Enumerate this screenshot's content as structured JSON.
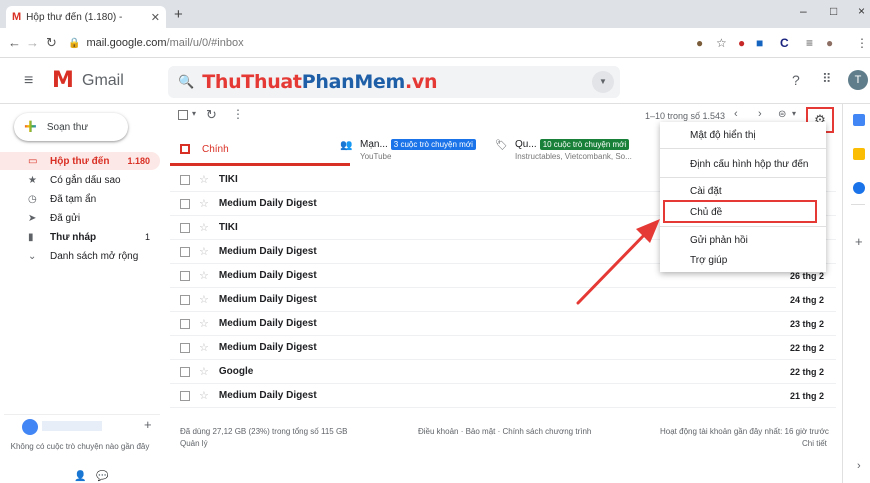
{
  "browser": {
    "tab_title": "Hộp thư đến (1.180) -",
    "tab_favicon": "M",
    "new_tab": "+",
    "url_host": "mail.google.com",
    "url_path": "/mail/u/0/#inbox",
    "win_min": "–",
    "win_max": "□",
    "win_close": "×"
  },
  "header": {
    "app_name": "Gmail",
    "logo_letter": "M",
    "watermark_part1": "ThuThuat",
    "watermark_part2": "PhanMem",
    "watermark_part3": ".vn",
    "avatar_letter": "T"
  },
  "sidebar": {
    "compose_label": "Soạn thư",
    "items": [
      {
        "label": "Hộp thư đến",
        "count": "1.180",
        "icon": "inbox-icon"
      },
      {
        "label": "Có gắn dấu sao",
        "count": "",
        "icon": "star-icon"
      },
      {
        "label": "Đã tạm ẩn",
        "count": "",
        "icon": "clock-icon"
      },
      {
        "label": "Đã gửi",
        "count": "",
        "icon": "send-icon"
      },
      {
        "label": "Thư nháp",
        "count": "1",
        "icon": "draft-icon"
      },
      {
        "label": "Danh sách mở rộng",
        "count": "",
        "icon": "chevron-down-icon"
      }
    ],
    "hangouts_empty": "Không có cuộc trò chuyện nào gần đây"
  },
  "toolbar": {
    "pagination": "1–10 trong số 1.543"
  },
  "categories": [
    {
      "title": "Chính",
      "sub": "",
      "badge": ""
    },
    {
      "title": "Mạn...",
      "sub": "YouTube",
      "badge": "3 cuộc trò chuyện mới"
    },
    {
      "title": "Qu...",
      "sub": "Instructables, Vietcombank, So...",
      "badge": "10 cuộc trò chuyện mới"
    }
  ],
  "messages": [
    {
      "sender": "TIKI",
      "date": ""
    },
    {
      "sender": "Medium Daily Digest",
      "date": ""
    },
    {
      "sender": "TIKI",
      "date": ""
    },
    {
      "sender": "Medium Daily Digest",
      "date": ""
    },
    {
      "sender": "Medium Daily Digest",
      "date": "26 thg 2"
    },
    {
      "sender": "Medium Daily Digest",
      "date": "24 thg 2"
    },
    {
      "sender": "Medium Daily Digest",
      "date": "23 thg 2"
    },
    {
      "sender": "Medium Daily Digest",
      "date": "22 thg 2"
    },
    {
      "sender": "Google",
      "date": "22 thg 2"
    },
    {
      "sender": "Medium Daily Digest",
      "date": "21 thg 2"
    }
  ],
  "settings_menu": {
    "density": "Mật độ hiển thị",
    "configure_inbox": "Định cấu hình hộp thư đến",
    "settings": "Cài đặt",
    "themes": "Chủ đề",
    "feedback": "Gửi phản hồi",
    "help": "Trợ giúp"
  },
  "footer": {
    "storage": "Đã dùng 27,12 GB (23%) trong tổng số 115 GB",
    "manage": "Quản lý",
    "links": "Điều khoản · Bảo mật · Chính sách chương trình",
    "activity": "Hoạt động tài khoản gần đây nhất: 16 giờ trước",
    "details": "Chi tiết"
  },
  "colors": {
    "accent_red": "#d93025",
    "badge_blue": "#1a73e8",
    "badge_green": "#188038",
    "highlight_red": "#e53935"
  }
}
